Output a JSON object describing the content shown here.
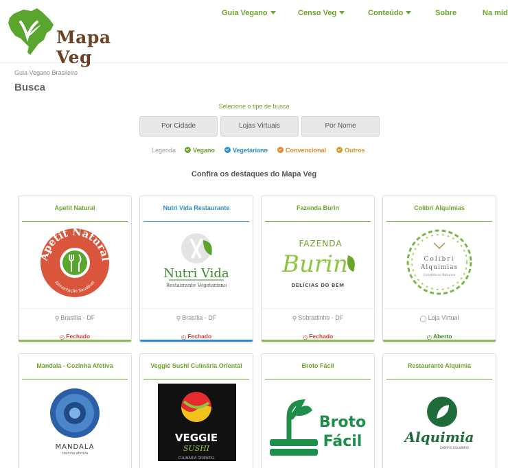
{
  "brand": {
    "name": "Mapa Veg",
    "logo_color": "#5aa52d",
    "brown": "#6b4226"
  },
  "nav": [
    {
      "label": "Guia Vegano",
      "dropdown": true
    },
    {
      "label": "Censo Veg",
      "dropdown": true
    },
    {
      "label": "Conteúdo",
      "dropdown": true
    },
    {
      "label": "Sobre",
      "dropdown": false
    },
    {
      "label": "Na mídia",
      "dropdown": false
    }
  ],
  "breadcrumb": "Guia Vegano Brasileiro",
  "page_title": "Busca",
  "search": {
    "label": "Selecione o tipo de busca",
    "buttons": [
      "Por Cidade",
      "Lojas Virtuais",
      "Por Nome"
    ]
  },
  "legend": {
    "title": "Legenda",
    "items": [
      {
        "label": "Vegano",
        "color": "#6aa52a"
      },
      {
        "label": "Vegetariano",
        "color": "#2b8fce"
      },
      {
        "label": "Convencional",
        "color": "#e8862a"
      },
      {
        "label": "Outros",
        "color": "#d49a2b"
      }
    ]
  },
  "highlights_title": "Confira os destaques do Mapa Veg",
  "cards": [
    {
      "name": "Apetit Natural",
      "location": "Brasília - DF",
      "status": "Fechado",
      "open": false,
      "type": "vegan",
      "logo_text": "Apetit Natural",
      "logo_sub": "Alimentação Saudável"
    },
    {
      "name": "Nutri Vida Restaurante",
      "location": "Brasília - DF",
      "status": "Fechado",
      "open": false,
      "type": "vegetarian",
      "logo_text": "Nutri Vida",
      "logo_sub": "Restaurante Vegetariano"
    },
    {
      "name": "Fazenda Burin",
      "location": "Sobradinho - DF",
      "status": "Fechado",
      "open": false,
      "type": "vegan",
      "logo_text": "Burin",
      "logo_top": "FAZENDA",
      "logo_sub": "DELÍCIAS DO BEM"
    },
    {
      "name": "Colibri Alquimias",
      "location": "Loja Virtual",
      "status": "Aberto",
      "open": true,
      "type": "vegan",
      "logo_text": "Colibri",
      "logo_text2": "Alquimias",
      "logo_sub": "Cosméticos Naturais"
    },
    {
      "name": "Mandala - Cozinha Afetiva",
      "type": "vegan",
      "logo_text": "MANDALA",
      "logo_sub": "cozinha afetiva"
    },
    {
      "name": "Veggie Sushi Culinária Oriental",
      "type": "vegan",
      "logo_text": "VEGGIE",
      "logo_text2": "SUSHI",
      "logo_sub": "CULINÁRIA ORIENTAL"
    },
    {
      "name": "Broto Fácil",
      "type": "vegan",
      "logo_text": "Broto",
      "logo_text2": "Fácil"
    },
    {
      "name": "Restaurante Alquimia",
      "type": "vegan",
      "logo_text": "Alquimia",
      "logo_sub": "SABOR E EQUILÍBRIO"
    }
  ]
}
